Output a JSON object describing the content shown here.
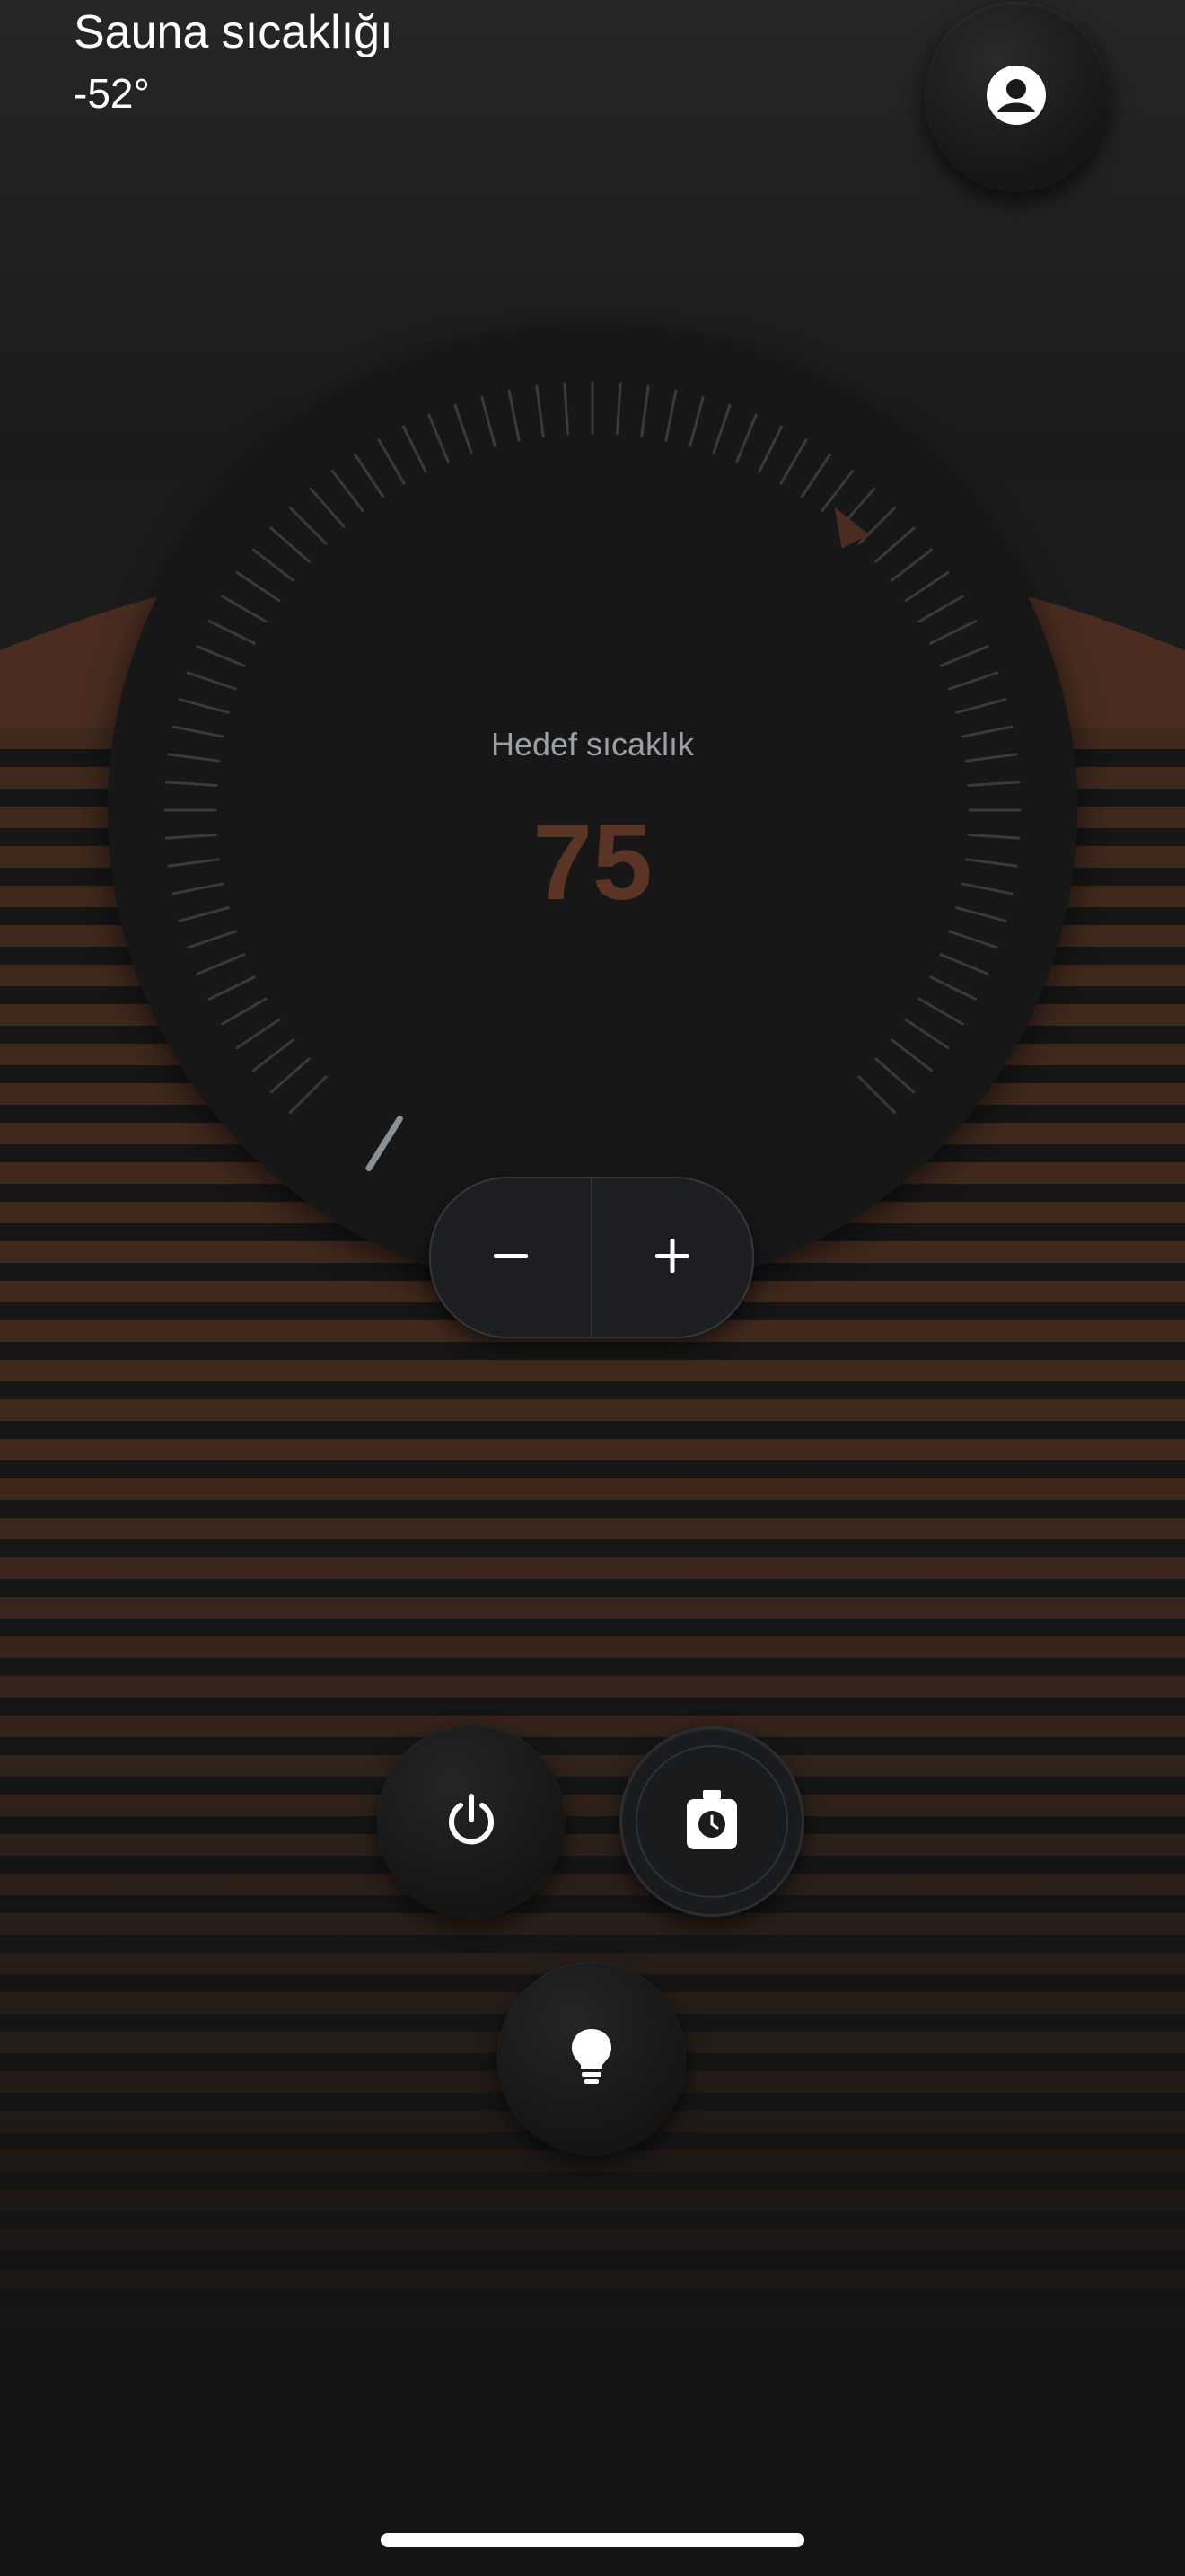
{
  "header": {
    "title": "Sauna sıcaklığı",
    "current_temperature": "-52°"
  },
  "dial": {
    "label": "Hedef sıcaklık",
    "value": "75",
    "colors": {
      "accent": "#5a3424",
      "tick": "#3a3a3a",
      "marker": "#4a2d20",
      "start_marker": "#8a9097"
    }
  },
  "stepper": {
    "decrement_icon": "minus-icon",
    "increment_icon": "plus-icon"
  },
  "controls": {
    "power_icon": "power-icon",
    "timer_icon": "timer-icon",
    "light_icon": "lightbulb-icon",
    "profile_icon": "user-icon"
  }
}
